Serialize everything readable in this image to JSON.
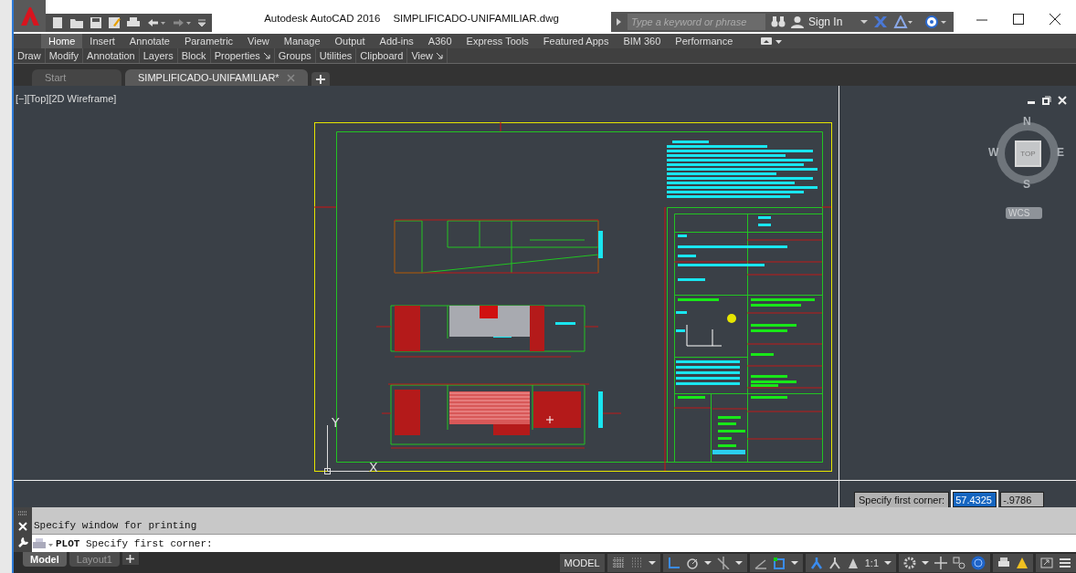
{
  "window": {
    "app_title": "Autodesk AutoCAD 2016",
    "file_title": "SIMPLIFICADO-UNIFAMILIAR.dwg"
  },
  "search": {
    "placeholder": "Type a keyword or phrase"
  },
  "sign_in": "Sign In",
  "ribbon_tabs": [
    {
      "label": "Home",
      "selected": true
    },
    {
      "label": "Insert",
      "selected": false
    },
    {
      "label": "Annotate",
      "selected": false
    },
    {
      "label": "Parametric",
      "selected": false
    },
    {
      "label": "View",
      "selected": false
    },
    {
      "label": "Manage",
      "selected": false
    },
    {
      "label": "Output",
      "selected": false
    },
    {
      "label": "Add-ins",
      "selected": false
    },
    {
      "label": "A360",
      "selected": false
    },
    {
      "label": "Express Tools",
      "selected": false
    },
    {
      "label": "Featured Apps",
      "selected": false
    },
    {
      "label": "BIM 360",
      "selected": false
    },
    {
      "label": "Performance",
      "selected": false
    }
  ],
  "panels": [
    {
      "label": "Draw",
      "launcher": false
    },
    {
      "label": "Modify",
      "launcher": false
    },
    {
      "label": "Annotation",
      "launcher": false
    },
    {
      "label": "Layers",
      "launcher": false
    },
    {
      "label": "Block",
      "launcher": false
    },
    {
      "label": "Properties",
      "launcher": true
    },
    {
      "label": "Groups",
      "launcher": false
    },
    {
      "label": "Utilities",
      "launcher": false
    },
    {
      "label": "Clipboard",
      "launcher": false
    },
    {
      "label": "View",
      "launcher": true
    }
  ],
  "file_tabs": [
    {
      "label": "Start",
      "selected": false,
      "closable": false
    },
    {
      "label": "SIMPLIFICADO-UNIFAMILIAR*",
      "selected": true,
      "closable": true
    }
  ],
  "viewport": {
    "controls": "[−][Top][2D Wireframe]"
  },
  "viewcube": {
    "north": "N",
    "east": "E",
    "south": "S",
    "west": "W",
    "face": "TOP",
    "ucs": "WCS"
  },
  "ucs_icon": {
    "y_label": "Y",
    "x_label": "X"
  },
  "dynamic_input": {
    "prompt": "Specify first corner:",
    "x_value": "57.4325",
    "y_value": "-.9786"
  },
  "command_line": {
    "history": "Specify window for printing",
    "input": "**PLOT** Specify first corner:"
  },
  "layout_tabs": [
    {
      "label": "Model",
      "selected": true
    },
    {
      "label": "Layout1",
      "selected": false
    }
  ],
  "status_bar": {
    "space": "MODEL",
    "scale": "1:1"
  }
}
